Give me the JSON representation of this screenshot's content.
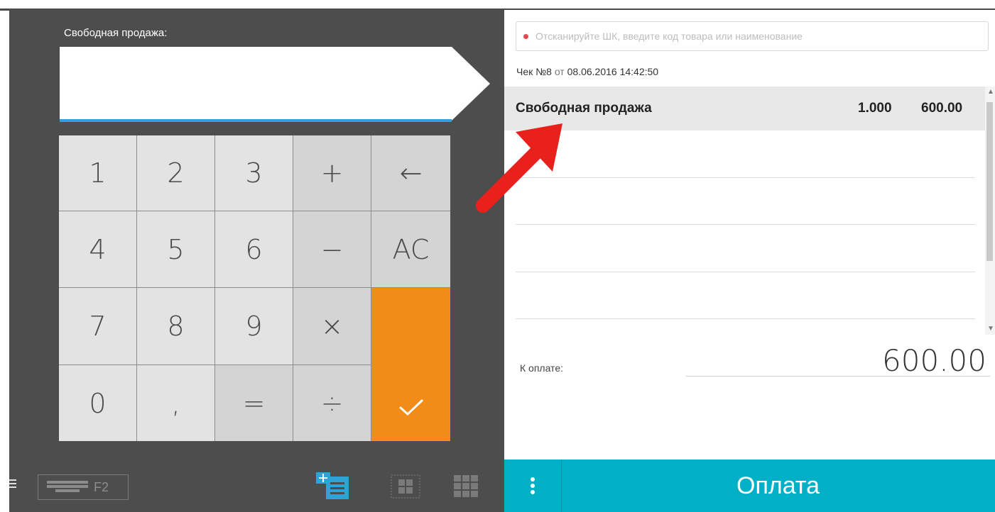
{
  "left_panel": {
    "free_sale_label": "Свободная продажа:",
    "keypad": {
      "keys": [
        "1",
        "2",
        "3",
        "+",
        "←",
        "4",
        "5",
        "6",
        "−",
        "AC",
        "7",
        "8",
        "9",
        "×",
        "0",
        ",",
        "=",
        "÷"
      ]
    },
    "toolbar": {
      "keyboard_hotkey": "F2"
    }
  },
  "right_panel": {
    "search_placeholder": "Отсканируйте ШК, введите код товара или наименование",
    "receipt": {
      "prefix": "Чек №8",
      "from_word": "от",
      "datetime": "08.06.2016 14:42:50"
    },
    "items": [
      {
        "name": "Свободная продажа",
        "qty": "1.000",
        "sum": "600.00"
      }
    ],
    "to_pay_label": "К оплате:",
    "to_pay_amount": "600.00",
    "pay_button_label": "Оплата"
  },
  "colors": {
    "panel_dark": "#4d4d4d",
    "confirm_orange": "#f08c17",
    "pay_teal": "#00b0c7",
    "accent_blue": "#2ea3d8",
    "arrow_red": "#e8211d"
  }
}
